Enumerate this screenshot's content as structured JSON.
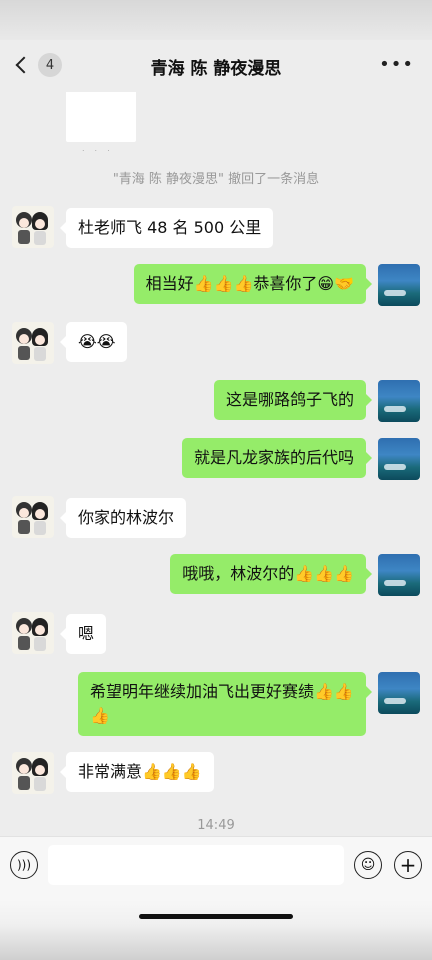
{
  "header": {
    "back_badge": "4",
    "title": "青海 陈 静夜漫思",
    "more_icon": "more-horizontal-icon"
  },
  "chat": {
    "recall_notice": "\"青海 陈 静夜漫思\" 撤回了一条消息",
    "messages": [
      {
        "side": "left",
        "text": "杜老师飞 48 名 500 公里"
      },
      {
        "side": "right",
        "text": "相当好👍👍👍恭喜你了😁🤝"
      },
      {
        "side": "left",
        "text": "😭😭"
      },
      {
        "side": "right",
        "text": "这是哪路鸽子飞的"
      },
      {
        "side": "right",
        "text": "就是凡龙家族的后代吗"
      },
      {
        "side": "left",
        "text": "你家的林波尔"
      },
      {
        "side": "right",
        "text": "哦哦，林波尔的👍👍👍"
      },
      {
        "side": "left",
        "text": "嗯"
      },
      {
        "side": "right",
        "text": "希望明年继续加油飞出更好赛绩👍👍👍"
      },
      {
        "side": "left",
        "text": "非常满意👍👍👍"
      }
    ],
    "timestamp": "14:49"
  },
  "input_bar": {
    "voice_icon": "voice-icon",
    "emoji_icon": "emoji-icon",
    "plus_icon": "plus-icon"
  },
  "colors": {
    "background": "#ededed",
    "bubble_right": "#95ec69",
    "bubble_left": "#ffffff"
  }
}
